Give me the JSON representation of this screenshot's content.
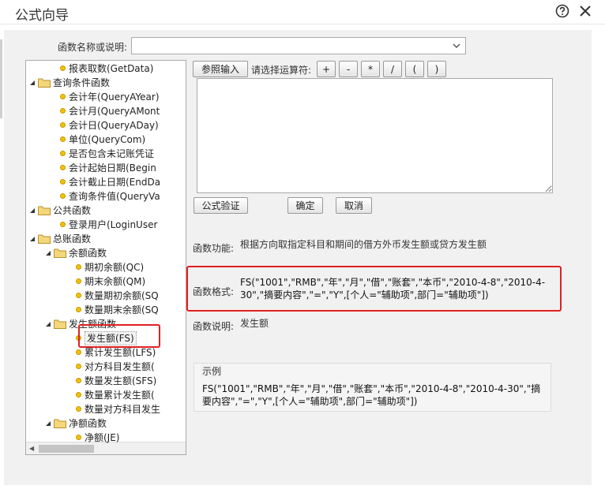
{
  "window": {
    "title": "公式向导"
  },
  "search": {
    "label": "函数名称或说明:",
    "value": ""
  },
  "tree": [
    {
      "text": "报表取数(GetData)",
      "kind": "leaf",
      "level": 2
    },
    {
      "text": "查询条件函数",
      "kind": "folder",
      "level": 1
    },
    {
      "text": "会计年(QueryAYear)",
      "kind": "leaf",
      "level": 2
    },
    {
      "text": "会计月(QueryAMont",
      "kind": "leaf",
      "level": 2
    },
    {
      "text": "会计日(QueryADay)",
      "kind": "leaf",
      "level": 2
    },
    {
      "text": "单位(QueryCom)",
      "kind": "leaf",
      "level": 2
    },
    {
      "text": "是否包含未记账凭证",
      "kind": "leaf",
      "level": 2
    },
    {
      "text": "会计起始日期(Begin",
      "kind": "leaf",
      "level": 2
    },
    {
      "text": "会计截止日期(EndDa",
      "kind": "leaf",
      "level": 2
    },
    {
      "text": "查询条件值(QueryVa",
      "kind": "leaf",
      "level": 2
    },
    {
      "text": "公共函数",
      "kind": "folder",
      "level": 1
    },
    {
      "text": "登录用户(LoginUser",
      "kind": "leaf",
      "level": 2
    },
    {
      "text": "总账函数",
      "kind": "folder",
      "level": 1
    },
    {
      "text": "余额函数",
      "kind": "folder",
      "level": 2
    },
    {
      "text": "期初余额(QC)",
      "kind": "leaf",
      "level": 3
    },
    {
      "text": "期末余额(QM)",
      "kind": "leaf",
      "level": 3
    },
    {
      "text": "数量期初余额(SQ",
      "kind": "leaf",
      "level": 3
    },
    {
      "text": "数量期末余额(SQ",
      "kind": "leaf",
      "level": 3
    },
    {
      "text": "发生额函数",
      "kind": "folder",
      "level": 2
    },
    {
      "text": "发生额(FS)",
      "kind": "leaf",
      "level": 3,
      "selected": true
    },
    {
      "text": "累计发生额(LFS)",
      "kind": "leaf",
      "level": 3
    },
    {
      "text": "对方科目发生额(",
      "kind": "leaf",
      "level": 3
    },
    {
      "text": "数量发生额(SFS)",
      "kind": "leaf",
      "level": 3
    },
    {
      "text": "数量累计发生额(",
      "kind": "leaf",
      "level": 3
    },
    {
      "text": "数量对方科目发生",
      "kind": "leaf",
      "level": 3
    },
    {
      "text": "净额函数",
      "kind": "folder",
      "level": 2
    },
    {
      "text": "净额(JE)",
      "kind": "leaf",
      "level": 3
    }
  ],
  "toolbar": {
    "reference_button": "参照输入",
    "operator_label": "请选择运算符:",
    "operators": [
      "+",
      "-",
      "*",
      "/",
      "(",
      ")"
    ]
  },
  "formula": {
    "value": ""
  },
  "actions": {
    "validate": "公式验证",
    "ok": "确定",
    "cancel": "取消"
  },
  "info": {
    "function_label": "函数功能:",
    "function_text": "根据方向取指定科目和期间的借方外币发生额或贷方发生额",
    "format_label": "函数格式:",
    "format_text": "FS(\"1001\",\"RMB\",\"年\",\"月\",\"借\",\"账套\",\"本币\",\"2010-4-8\",\"2010-4-30\",\"摘要内容\",\"=\",\"Y\",[个人=\"辅助项\",部门=\"辅助项\"])",
    "desc_label": "函数说明:",
    "desc_text": "发生额"
  },
  "example": {
    "legend": "示例",
    "text": "FS(\"1001\",\"RMB\",\"年\",\"月\",\"借\",\"账套\",\"本币\",\"2010-4-8\",\"2010-4-30\",\"摘要内容\",\"=\",\"Y\",[个人=\"辅助项\",部门=\"辅助项\"])"
  },
  "colors": {
    "highlight": "#e02020",
    "folder": "#f4d77a",
    "leaf_dot": "#f2c200"
  },
  "icons": {
    "help": "help-icon",
    "close": "close-icon",
    "folder": "folder-icon",
    "leaf": "function-dot-icon"
  }
}
